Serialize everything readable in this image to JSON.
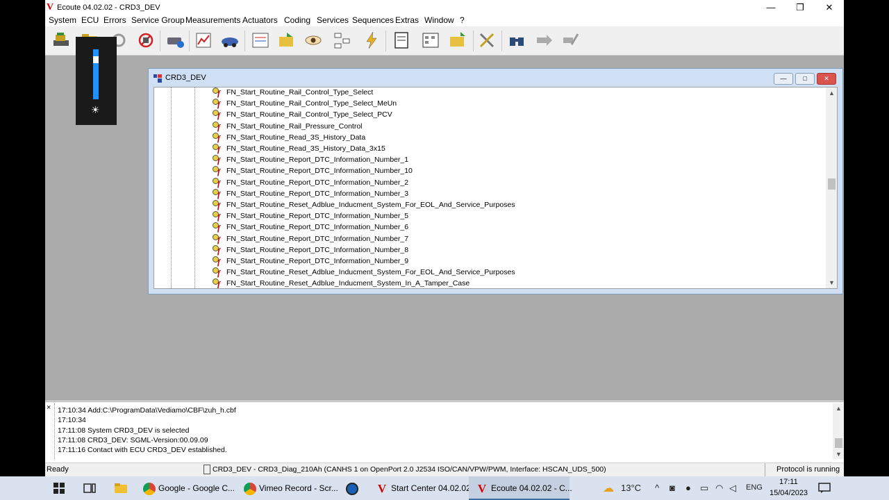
{
  "window": {
    "title": "Ecoute 04.02.02 - CRD3_DEV",
    "logo": "V",
    "minimize": "—",
    "maximize": "❒",
    "close": "✕"
  },
  "menu": [
    "System",
    "ECU",
    "Errors",
    "Service Group",
    "Measurements",
    "Actuators",
    "Coding",
    "Services",
    "Sequences",
    "Extras",
    "Window",
    "?"
  ],
  "toolbar": {
    "icons": [
      "connect-icon",
      "folder-icon",
      "refresh-icon",
      "disconnect-icon",
      "ecu-info-icon",
      "chart-icon",
      "car-icon",
      "report-icon",
      "open-file-icon",
      "eye-icon",
      "tree-icon",
      "flash-icon",
      "document-icon",
      "calculator-icon",
      "open-folder-icon",
      "tools-icon",
      "binoculars-icon",
      "arrow-icon",
      "plug-icon"
    ]
  },
  "child_window": {
    "title": "CRD3_DEV",
    "min": "—",
    "max": "□",
    "close": "✕"
  },
  "tree_items": [
    "FN_Start_Routine_Rail_Control_Type_Select",
    "FN_Start_Routine_Rail_Control_Type_Select_MeUn",
    "FN_Start_Routine_Rail_Control_Type_Select_PCV",
    "FN_Start_Routine_Rail_Pressure_Control",
    "FN_Start_Routine_Read_3S_History_Data",
    "FN_Start_Routine_Read_3S_History_Data_3x15",
    "FN_Start_Routine_Report_DTC_Information_Number_1",
    "FN_Start_Routine_Report_DTC_Information_Number_10",
    "FN_Start_Routine_Report_DTC_Information_Number_2",
    "FN_Start_Routine_Report_DTC_Information_Number_3",
    "FN_Start_Routine_Reset_Adblue_Inducment_System_For_EOL_And_Service_Purposes",
    "FN_Start_Routine_Report_DTC_Information_Number_5",
    "FN_Start_Routine_Report_DTC_Information_Number_6",
    "FN_Start_Routine_Report_DTC_Information_Number_7",
    "FN_Start_Routine_Report_DTC_Information_Number_8",
    "FN_Start_Routine_Report_DTC_Information_Number_9",
    "FN_Start_Routine_Reset_Adblue_Inducment_System_For_EOL_And_Service_Purposes",
    "FN_Start_Routine_Reset_Adblue_Inducment_System_In_A_Tamper_Case"
  ],
  "log": {
    "close": "×",
    "lines": [
      "17:10:34 Add:C:\\ProgramData\\Vediamo\\CBF\\zuh_h.cbf",
      "17:10:34",
      "17:11:08 System CRD3_DEV is selected",
      "17:11:08 CRD3_DEV: SGML-Version:00.09.09",
      "17:11:16 Contact with ECU CRD3_DEV established."
    ]
  },
  "status": {
    "left": "Ready",
    "center": "CRD3_DEV - CRD3_Diag_210Ah (CANHS 1 on OpenPort 2.0 J2534 ISO/CAN/VPW/PWM, Interface: HSCAN_UDS_500)",
    "right": "Protocol is running"
  },
  "brightness": {
    "level": 0.86,
    "icon": "sun-icon"
  },
  "taskbar": {
    "apps": [
      {
        "label": "Google - Google C...",
        "icon": "chrome-icon"
      },
      {
        "label": "Vimeo Record - Scr...",
        "icon": "chrome-icon"
      },
      {
        "label": "",
        "icon": "teamviewer-icon"
      },
      {
        "label": "Start Center 04.02.02",
        "icon": "vediamo-icon"
      },
      {
        "label": "Ecoute 04.02.02 - C...",
        "icon": "vediamo-icon"
      }
    ],
    "weather": "13°C",
    "lang": "ENG",
    "time": "17:11",
    "date": "15/04/2023"
  }
}
